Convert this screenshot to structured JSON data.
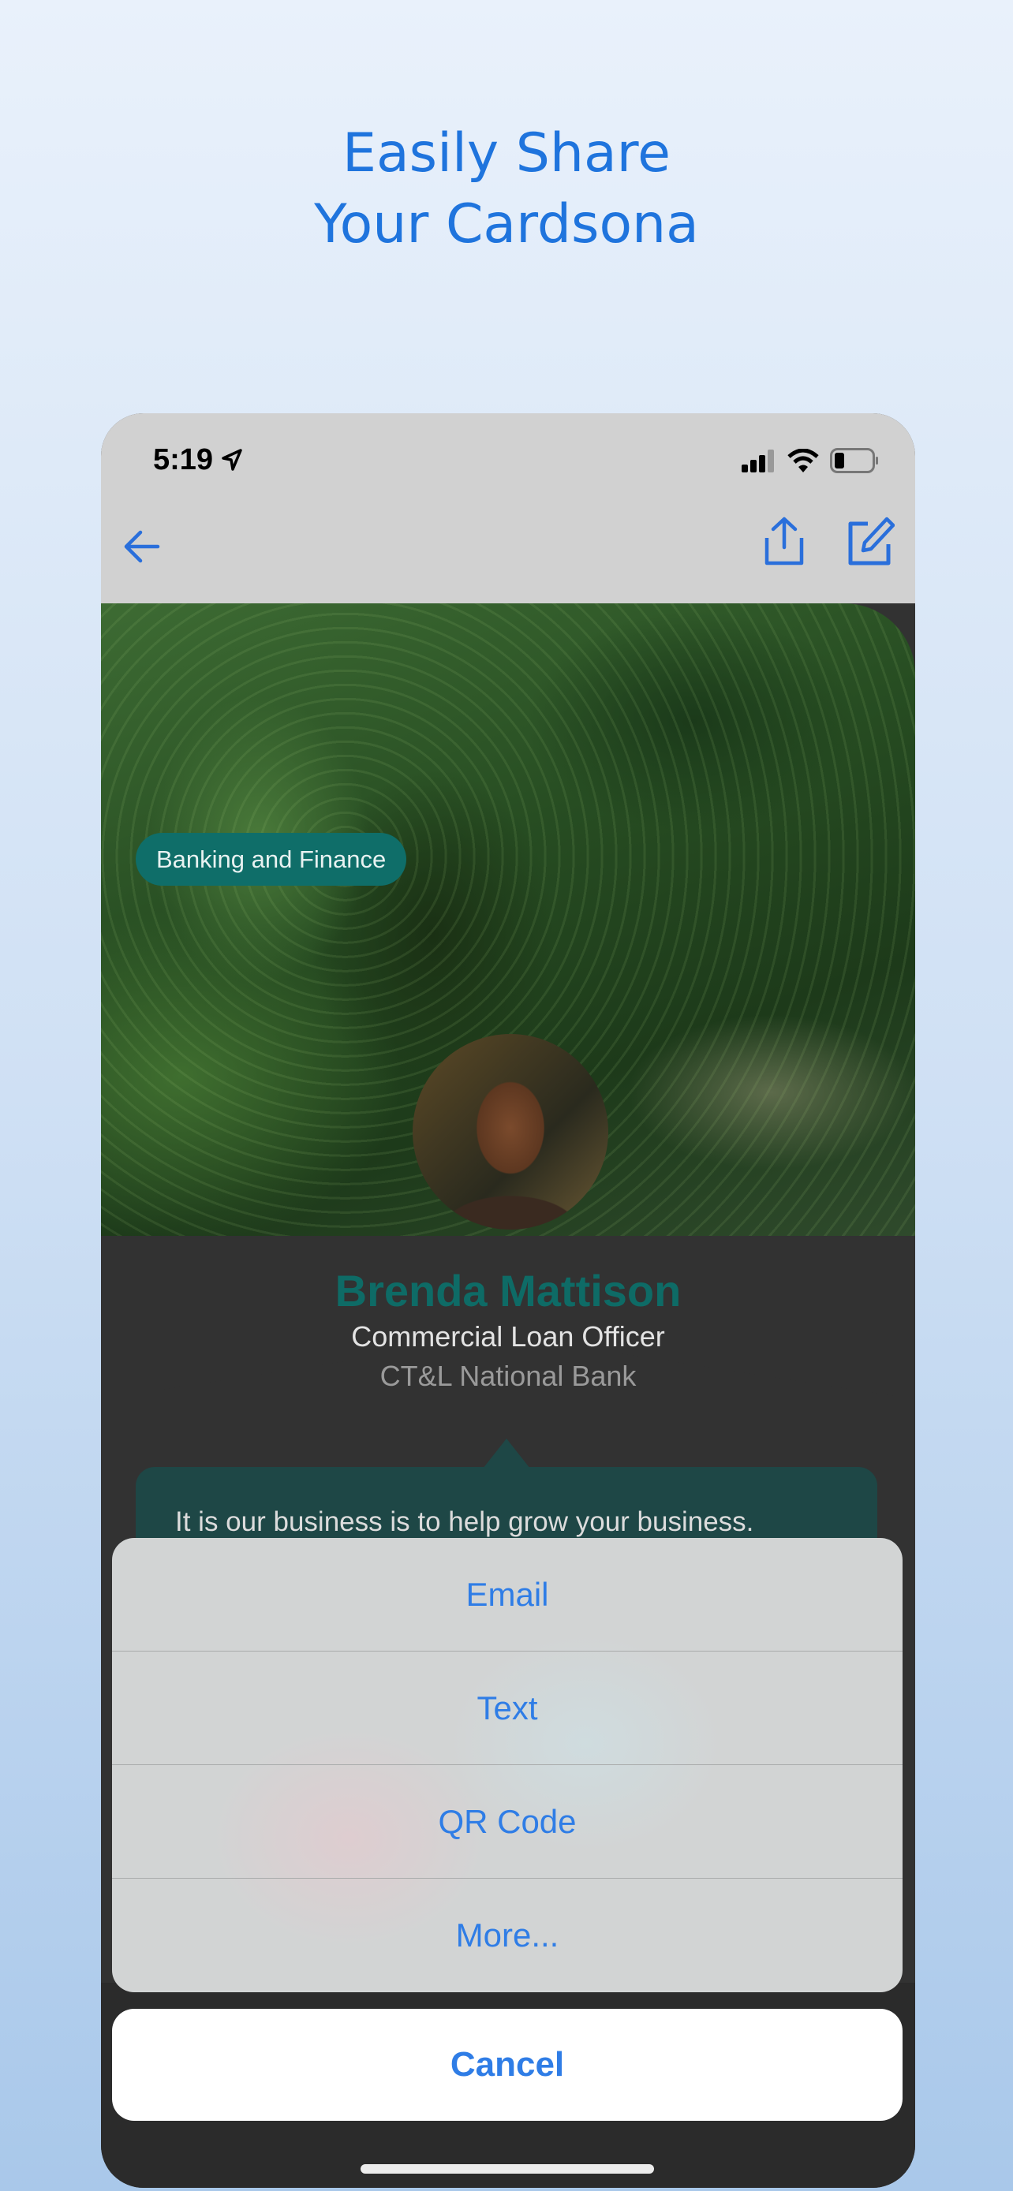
{
  "headline": {
    "line1": "Easily Share",
    "line2": "Your Cardsona"
  },
  "status_bar": {
    "time": "5:19",
    "icons": [
      "location-arrow-icon",
      "signal-icon",
      "wifi-icon",
      "battery-icon"
    ]
  },
  "nav": {
    "icons": [
      "back-arrow-icon",
      "share-icon",
      "edit-icon"
    ]
  },
  "card": {
    "category": "Banking and Finance",
    "name": "Brenda Mattison",
    "job_title": "Commercial Loan Officer",
    "company": "CT&L National Bank",
    "bio": "It is our business is to help grow your business."
  },
  "action_sheet": {
    "options": [
      {
        "label": "Email"
      },
      {
        "label": "Text"
      },
      {
        "label": "QR Code"
      },
      {
        "label": "More..."
      }
    ],
    "cancel": "Cancel"
  },
  "colors": {
    "accent": "#2f7de6",
    "brand_teal": "#0e6b66",
    "card_bg": "#323232",
    "headline": "#1f74dd"
  }
}
